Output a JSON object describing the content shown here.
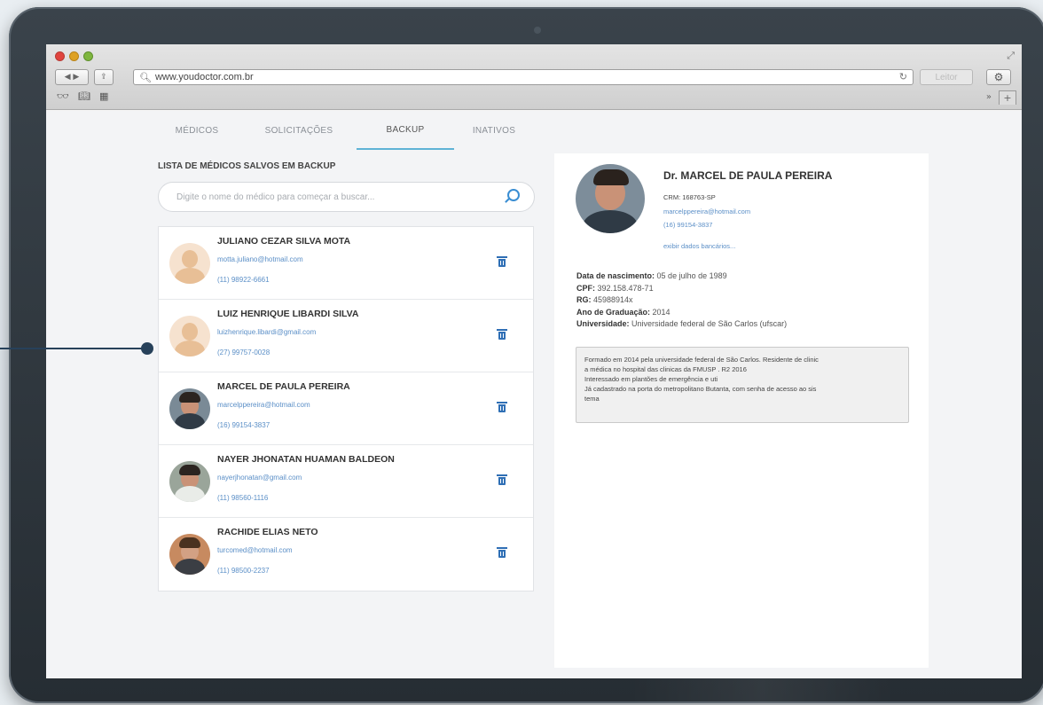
{
  "browser": {
    "url": "www.youdoctor.com.br",
    "reader_label": "Leitor",
    "more_label": "»",
    "new_tab_label": "+"
  },
  "tabs": [
    {
      "label": "MÉDICOS"
    },
    {
      "label": "SOLICITAÇÕES"
    },
    {
      "label": "BACKUP"
    },
    {
      "label": "INATIVOS"
    }
  ],
  "active_tab": "BACKUP",
  "list": {
    "title": "LISTA DE MÉDICOS SALVOS EM BACKUP",
    "search_placeholder": "Digite o nome do médico para começar a buscar...",
    "items": [
      {
        "name": "JULIANO CEZAR SILVA MOTA",
        "email": "motta.juliano@hotmail.com",
        "phone": "(11) 98922-6661",
        "avatar": "placeholder-avatar"
      },
      {
        "name": "LUIZ HENRIQUE LIBARDI SILVA",
        "email": "luizhenrique.libardi@gmail.com",
        "phone": "(27) 99757-0028",
        "avatar": "placeholder-avatar"
      },
      {
        "name": "MARCEL DE PAULA PEREIRA",
        "email": "marcelppereira@hotmail.com",
        "phone": "(16) 99154-3837",
        "avatar": "photo"
      },
      {
        "name": "NAYER JHONATAN HUAMAN BALDEON",
        "email": "nayerjhonatan@gmail.com",
        "phone": "(11) 98560-1116",
        "avatar": "photo"
      },
      {
        "name": "RACHIDE ELIAS NETO",
        "email": "turcomed@hotmail.com",
        "phone": "(11) 98500-2237",
        "avatar": "photo"
      }
    ]
  },
  "detail": {
    "name": "Dr. MARCEL DE PAULA PEREIRA",
    "crm": "CRM: 168763-SP",
    "email": "marcelppereira@hotmail.com",
    "phone": "(16) 99154-3837",
    "bank_link": "exibir dados bancários...",
    "birth_label": "Data de nascimento:",
    "birth_value": "05 de julho de 1989",
    "cpf_label": "CPF:",
    "cpf_value": "392.158.478-71",
    "rg_label": "RG:",
    "rg_value": "45988914x",
    "grad_label": "Ano de Graduação:",
    "grad_value": "2014",
    "univ_label": "Universidade:",
    "univ_value": "Universidade federal de São Carlos (ufscar)",
    "notes": [
      "Formado em 2014 pela universidade federal de São Carlos. Residente de clinic",
      "a médica no hospital das clinicas da FMUSP . R2 2016",
      "Interessado em plantões de emergência e uti",
      "Já cadastrado na porta do metropolitano Butanta, com senha de acesso ao sis",
      "tema"
    ]
  },
  "colors": {
    "accent": "#3a8ed3",
    "link": "#5b8fc7",
    "trash": "#2f6fb5",
    "tab_underline": "#5fb3d6"
  }
}
